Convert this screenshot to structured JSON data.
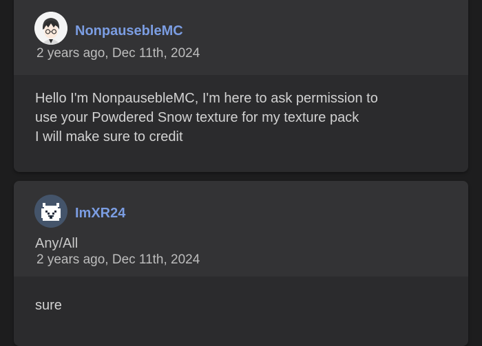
{
  "posts": [
    {
      "username": "NonpausebleMC",
      "avatar_icon": "anime-avatar-icon",
      "timestamp": "2 years ago, Dec 11th, 2024",
      "message_lines": [
        "Hello I'm NonpausebleMC, I'm here to ask permission to",
        "use your Powdered Snow texture for my texture pack",
        "I will make sure to credit"
      ]
    },
    {
      "username": "ImXR24",
      "avatar_icon": "pixel-cat-avatar-icon",
      "subtitle": "Any/All",
      "timestamp": "2 years ago, Dec 11th, 2024",
      "message_lines": [
        "sure"
      ]
    }
  ],
  "colors": {
    "background": "#1d1d1e",
    "card_header": "#333335",
    "card_body": "#2b2b2d",
    "username": "#7b9de2",
    "text": "#d2d2d2"
  }
}
